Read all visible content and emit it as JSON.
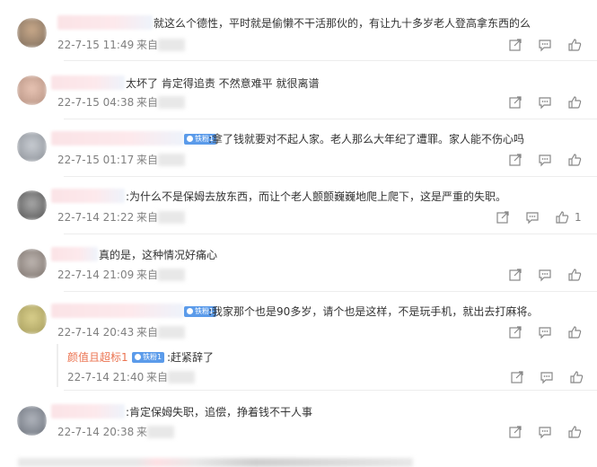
{
  "comments": [
    {
      "text": "就这么个德性，平时就是偷懒不干活那伙的，有让九十多岁老人登高拿东西的么",
      "time": "22-7-15 11:49",
      "source": "来自",
      "likes": ""
    },
    {
      "text": "太坏了 肯定得追责 不然意难平 就很离谱",
      "time": "22-7-15 04:38",
      "source": "来自",
      "likes": ""
    },
    {
      "text": ":拿了钱就要对不起人家。老人那么大年纪了遭罪。家人能不伤心吗",
      "time": "22-7-15 01:17",
      "source": "来自",
      "badge": "铁粉1",
      "likes": ""
    },
    {
      "text": ":为什么不是保姆去放东西，而让个老人颤颤巍巍地爬上爬下，这是严重的失职。",
      "time": "22-7-14 21:22",
      "source": "来自",
      "likes": "1"
    },
    {
      "text": "真的是，这种情况好痛心",
      "time": "22-7-14 21:09",
      "source": "来自",
      "likes": ""
    },
    {
      "text": ":我家那个也是90多岁，请个也是这样，不是玩手机，就出去打麻将。",
      "time": "22-7-14 20:43",
      "source": "来自",
      "badge": "铁粉1",
      "likes": ""
    },
    {
      "text": ":肯定保姆失职，追偿，挣着钱不干人事",
      "time": "22-7-14 20:38",
      "source": "来",
      "likes": ""
    }
  ],
  "reply": {
    "name": "颜值且超标1",
    "badge": "铁粉1",
    "text": ":赶紧辞了",
    "time": "22-7-14 21:40",
    "source": "来自"
  },
  "icons": {
    "forward": "forward-icon",
    "comment": "comment-icon",
    "like": "like-icon"
  },
  "colors": {
    "name": "#eb7350",
    "badge": "#5b9bea",
    "time": "#808080"
  }
}
